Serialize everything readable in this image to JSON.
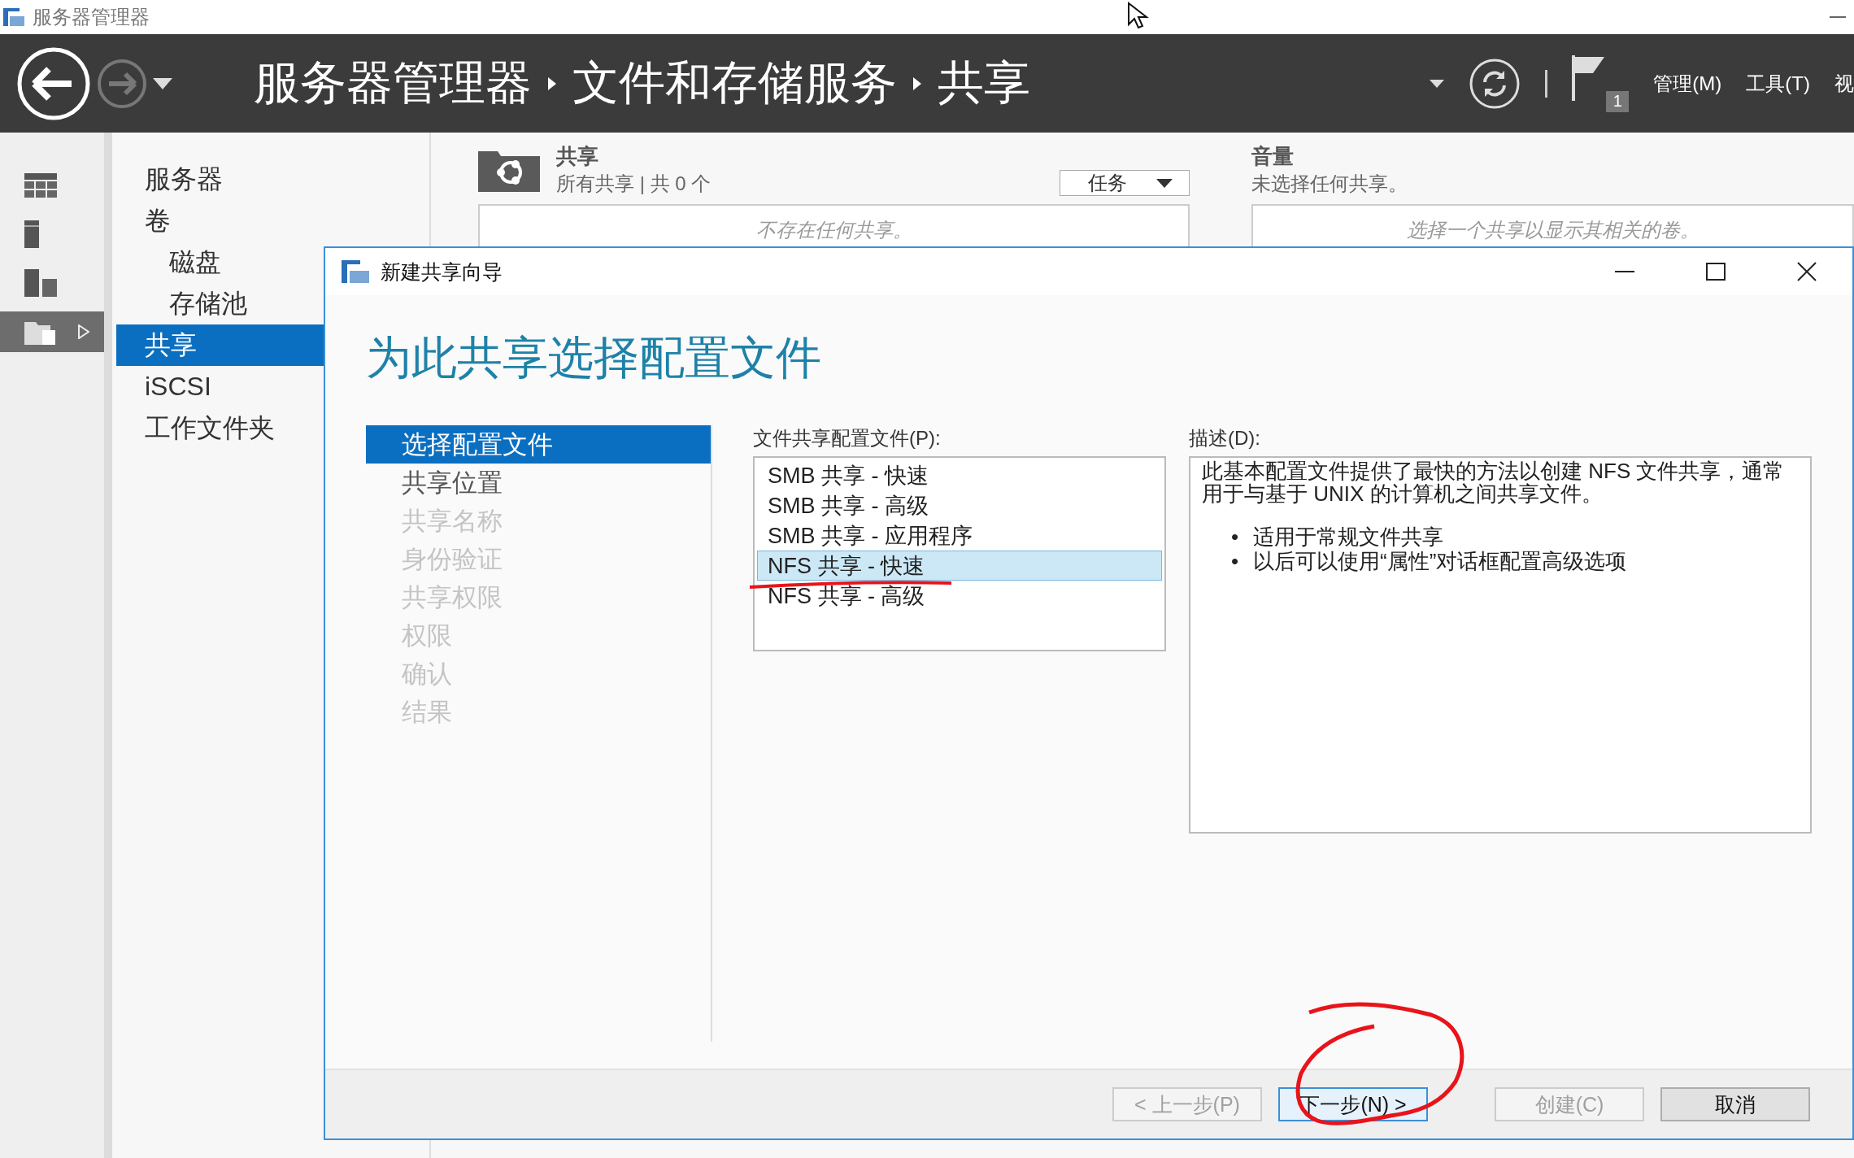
{
  "window": {
    "title": "服务器管理器"
  },
  "nav": {
    "breadcrumb": [
      "服务器管理器",
      "文件和存储服务",
      "共享"
    ],
    "flag_count": "1",
    "menus": [
      "管理(M)",
      "工具(T)",
      "视"
    ]
  },
  "icon_strip": [
    {
      "kind": "dashboard",
      "selected": false
    },
    {
      "kind": "server",
      "selected": false
    },
    {
      "kind": "servers",
      "selected": false
    },
    {
      "kind": "files",
      "selected": true
    }
  ],
  "sidebar": {
    "items": [
      {
        "label": "服务器",
        "selected": false
      },
      {
        "label": "卷",
        "selected": false,
        "children": [
          {
            "label": "磁盘",
            "selected": false
          },
          {
            "label": "存储池",
            "selected": false
          }
        ]
      },
      {
        "label": "共享",
        "selected": true
      },
      {
        "label": "iSCSI",
        "selected": false
      },
      {
        "label": "工作文件夹",
        "selected": false
      }
    ]
  },
  "shares_panel": {
    "title": "共享",
    "subtitle": "所有共享 | 共 0 个",
    "tasks_button": "任务",
    "empty_text": "不存在任何共享。"
  },
  "volume_panel": {
    "title": "音量",
    "subtitle": "未选择任何共享。",
    "empty_text": "选择一个共享以显示其相关的卷。"
  },
  "dialog": {
    "title": "新建共享向导",
    "heading": "为此共享选择配置文件",
    "steps": [
      {
        "label": "选择配置文件",
        "selected": true,
        "disabled": false
      },
      {
        "label": "共享位置",
        "selected": false,
        "disabled": false
      },
      {
        "label": "共享名称",
        "selected": false,
        "disabled": true
      },
      {
        "label": "身份验证",
        "selected": false,
        "disabled": true
      },
      {
        "label": "共享权限",
        "selected": false,
        "disabled": true
      },
      {
        "label": "权限",
        "selected": false,
        "disabled": true
      },
      {
        "label": "确认",
        "selected": false,
        "disabled": true
      },
      {
        "label": "结果",
        "selected": false,
        "disabled": true
      }
    ],
    "profile_label": "文件共享配置文件(P):",
    "profiles": [
      {
        "label": "SMB 共享 - 快速",
        "selected": false
      },
      {
        "label": "SMB 共享 - 高级",
        "selected": false
      },
      {
        "label": "SMB 共享 - 应用程序",
        "selected": false
      },
      {
        "label": "NFS 共享 - 快速",
        "selected": true
      },
      {
        "label": "NFS 共享 - 高级",
        "selected": false
      }
    ],
    "description_label": "描述(D):",
    "description": "此基本配置文件提供了最快的方法以创建 NFS 文件共享，通常用于与基于 UNIX 的计算机之间共享文件。",
    "bullets": [
      {
        "marker": "•",
        "text": "适用于常规文件共享"
      },
      {
        "marker": "•",
        "text": "以后可以使用“属性”对话框配置高级选项"
      }
    ],
    "buttons": [
      {
        "label": "< 上一步(P)",
        "disabled": true,
        "focused": false
      },
      {
        "label": "下一步(N) >",
        "disabled": false,
        "focused": true
      },
      {
        "label": "创建(C)",
        "disabled": true,
        "focused": false
      },
      {
        "label": "取消",
        "disabled": false,
        "focused": false
      }
    ]
  }
}
